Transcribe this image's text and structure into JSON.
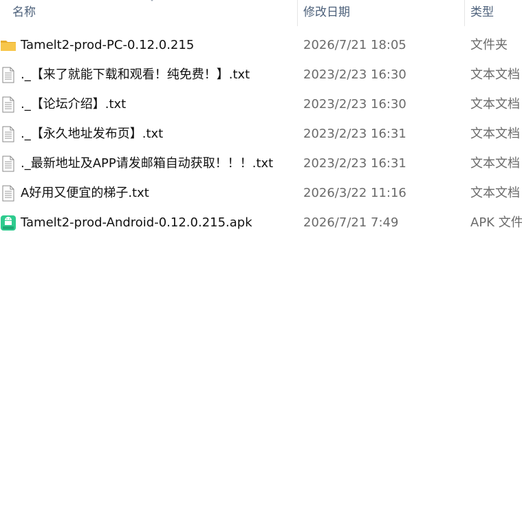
{
  "columns": {
    "name": "名称",
    "date_modified": "修改日期",
    "type": "类型"
  },
  "files": [
    {
      "icon": "folder-icon",
      "name": "Tamelt2-prod-PC-0.12.0.215",
      "date": "2026/7/21 18:05",
      "type": "文件夹"
    },
    {
      "icon": "text-file-icon",
      "name": "._【来了就能下载和观看！纯免费！】.txt",
      "date": "2023/2/23 16:30",
      "type": "文本文档"
    },
    {
      "icon": "text-file-icon",
      "name": "._【论坛介绍】.txt",
      "date": "2023/2/23 16:30",
      "type": "文本文档"
    },
    {
      "icon": "text-file-icon",
      "name": "._【永久地址发布页】.txt",
      "date": "2023/2/23 16:31",
      "type": "文本文档"
    },
    {
      "icon": "text-file-icon",
      "name": "._最新地址及APP请发邮箱自动获取！！！.txt",
      "date": "2023/2/23 16:31",
      "type": "文本文档"
    },
    {
      "icon": "text-file-icon",
      "name": "A好用又便宜的梯子.txt",
      "date": "2026/3/22 11:16",
      "type": "文本文档"
    },
    {
      "icon": "apk-file-icon",
      "name": "Tamelt2-prod-Android-0.12.0.215.apk",
      "date": "2026/7/21 7:49",
      "type": "APK 文件"
    }
  ],
  "colors": {
    "header_text": "#4c607a",
    "folder": "#f7c64a",
    "apk": "#2ecb8e"
  }
}
